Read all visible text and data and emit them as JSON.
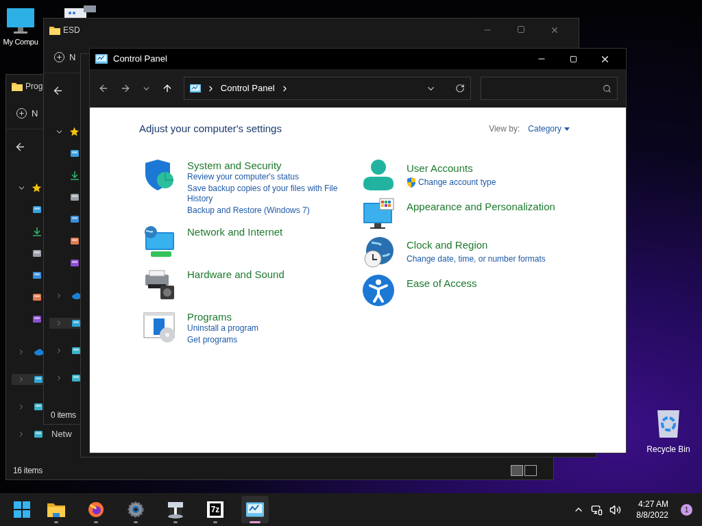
{
  "desktop_icons": [
    {
      "label": "My Compu"
    },
    {
      "label": "Recycle Bin"
    }
  ],
  "background_windows": [
    {
      "title": "Prog",
      "new_label": "N",
      "sidebar_label": "Netw",
      "status": "16 items"
    },
    {
      "title": "ESD",
      "new_label": "N",
      "status": "0 items"
    }
  ],
  "window": {
    "title": "Control Panel",
    "address": "Control Panel",
    "heading": "Adjust your computer's settings",
    "view_by_label": "View by:",
    "view_by_value": "Category",
    "columns": [
      [
        {
          "title": "System and Security",
          "links": [
            {
              "text": "Review your computer's status",
              "shielded": false
            },
            {
              "text": "Save backup copies of your files with File History",
              "shielded": false
            },
            {
              "text": "Backup and Restore (Windows 7)",
              "shielded": false
            }
          ]
        },
        {
          "title": "Network and Internet"
        },
        {
          "title": "Hardware and Sound"
        },
        {
          "title": "Programs",
          "links": [
            {
              "text": "Uninstall a program",
              "shielded": false
            },
            {
              "text": "Get programs",
              "shielded": false
            }
          ]
        }
      ],
      [
        {
          "title": "User Accounts",
          "links": [
            {
              "text": "Change account type",
              "shielded": true
            }
          ]
        },
        {
          "title": "Appearance and Personalization"
        },
        {
          "title": "Clock and Region",
          "links": [
            {
              "text": "Change date, time, or number formats",
              "shielded": false
            }
          ]
        },
        {
          "title": "Ease of Access"
        }
      ]
    ]
  },
  "taskbar": {
    "apps": [
      {
        "kind": "files",
        "selected": false
      },
      {
        "kind": "browser",
        "selected": false
      },
      {
        "kind": "settings",
        "selected": false
      },
      {
        "kind": "tool",
        "selected": false
      },
      {
        "kind": "archive",
        "label": "7z",
        "selected": false
      },
      {
        "kind": "control",
        "selected": true
      }
    ],
    "time": "4:27 AM",
    "date": "8/8/2022",
    "notifications": "1"
  }
}
